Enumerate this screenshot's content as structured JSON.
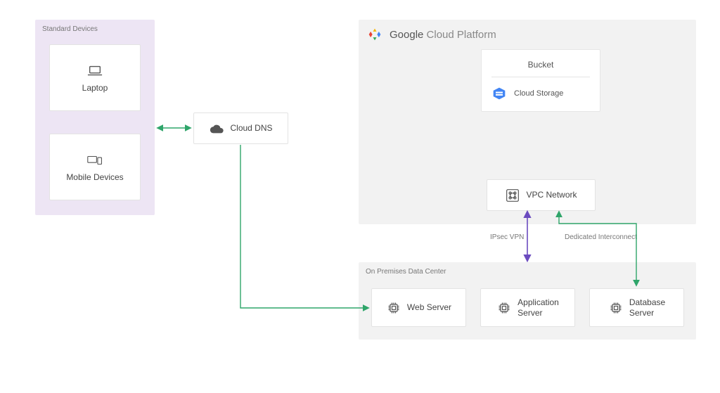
{
  "zones": {
    "devices": {
      "title": "Standard Devices"
    },
    "onprem": {
      "title": "On Premises Data Center"
    }
  },
  "gcp": {
    "brand_strong": "Google",
    "brand_light": "Cloud Platform"
  },
  "devices": {
    "laptop": {
      "label": "Laptop"
    },
    "mobile": {
      "label": "Mobile Devices"
    }
  },
  "dns": {
    "label": "Cloud DNS"
  },
  "bucket": {
    "title": "Bucket",
    "storage": {
      "label": "Cloud Storage"
    }
  },
  "vpc": {
    "label": "VPC Network"
  },
  "onprem": {
    "web": {
      "label": "Web Server"
    },
    "app": {
      "label": "Application\nServer"
    },
    "db": {
      "label": "Database\nServer"
    }
  },
  "edges": {
    "ipsec": {
      "label": "IPsec VPN"
    },
    "dedicated": {
      "label": "Dedicated Interconnect"
    }
  }
}
